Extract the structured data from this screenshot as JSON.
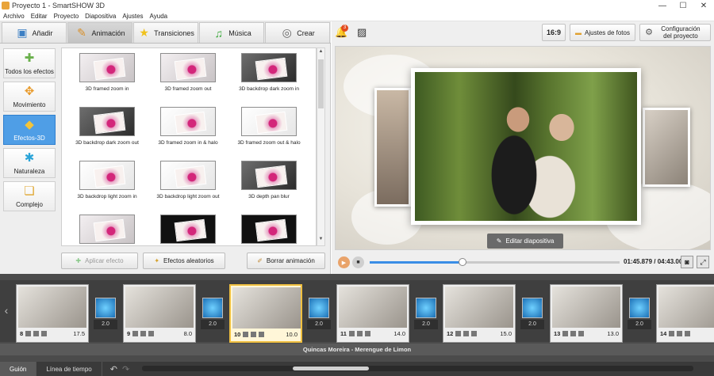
{
  "window": {
    "title": "Proyecto 1 - SmartSHOW 3D",
    "controls": [
      "—",
      "☐",
      "✕"
    ]
  },
  "menu": [
    "Archivo",
    "Editar",
    "Proyecto",
    "Diapositiva",
    "Ajustes",
    "Ayuda"
  ],
  "tabs": [
    {
      "label": "Añadir",
      "icon": "add-photo-icon"
    },
    {
      "label": "Animación",
      "icon": "palette-icon",
      "active": true
    },
    {
      "label": "Transiciones",
      "icon": "star-icon"
    },
    {
      "label": "Música",
      "icon": "music-note-icon"
    },
    {
      "label": "Crear",
      "icon": "film-reel-icon"
    }
  ],
  "categories": [
    {
      "label": "Todos los efectos",
      "icon": "puzzle-icon"
    },
    {
      "label": "Movimiento",
      "icon": "move-arrows-icon"
    },
    {
      "label": "Efectos-3D",
      "icon": "cube-icon",
      "active": true
    },
    {
      "label": "Naturaleza",
      "icon": "snowflake-icon"
    },
    {
      "label": "Complejo",
      "icon": "layers-icon"
    }
  ],
  "effects": [
    {
      "label": "3D framed zoom in",
      "style": "normal"
    },
    {
      "label": "3D framed zoom out",
      "style": "normal"
    },
    {
      "label": "3D backdrop dark zoom in",
      "style": "dark"
    },
    {
      "label": "3D backdrop dark zoom out",
      "style": "dark"
    },
    {
      "label": "3D framed zoom in & halo",
      "style": "light"
    },
    {
      "label": "3D framed zoom out & halo",
      "style": "light"
    },
    {
      "label": "3D backdrop light zoom in",
      "style": "light"
    },
    {
      "label": "3D backdrop light zoom out",
      "style": "light"
    },
    {
      "label": "3D depth pan blur",
      "style": "dark"
    },
    {
      "label": "",
      "style": "normal"
    },
    {
      "label": "",
      "style": "film"
    },
    {
      "label": "",
      "style": "film"
    }
  ],
  "actions": {
    "apply": "Aplicar efecto",
    "random": "Efectos aleatorios",
    "clear": "Borrar animación"
  },
  "right_toolbar": {
    "notifications_count": "3",
    "aspect": "16:9",
    "photo_settings": "Ajustes de fotos",
    "project_settings": "Configuración del proyecto"
  },
  "preview": {
    "edit_slide": "Editar diapositiva"
  },
  "player": {
    "time": "01:45.879 / 04:43.000",
    "progress": 0.373
  },
  "slides": [
    {
      "number": "8",
      "duration": "17.5"
    },
    {
      "number": "9",
      "duration": "8.0"
    },
    {
      "number": "10",
      "duration": "10.0",
      "selected": true
    },
    {
      "number": "11",
      "duration": "14.0"
    },
    {
      "number": "12",
      "duration": "15.0"
    },
    {
      "number": "13",
      "duration": "13.0"
    },
    {
      "number": "14",
      "duration": ""
    }
  ],
  "transitions": [
    "2.0",
    "2.0",
    "2.0",
    "2.0",
    "2.0",
    "2.0"
  ],
  "audio_track": "Quincas Moreira - Merengue de Limon",
  "bottom_tabs": [
    {
      "label": "Guión",
      "active": true
    },
    {
      "label": "Línea de tiempo"
    }
  ]
}
